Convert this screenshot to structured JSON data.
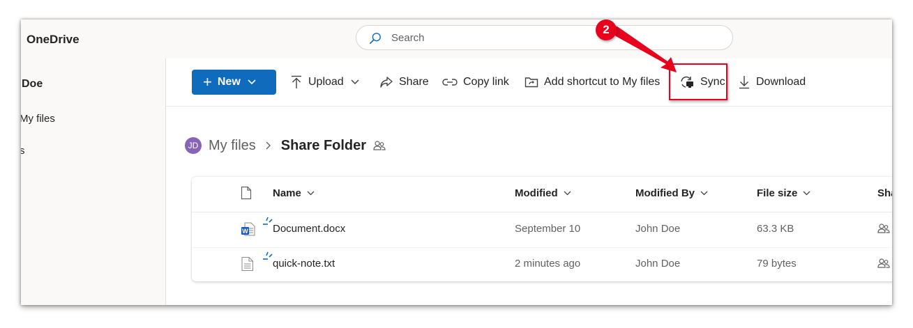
{
  "app": {
    "title": "OneDrive"
  },
  "search": {
    "placeholder": "Search"
  },
  "sidebar": {
    "user": "Doe",
    "items": [
      {
        "label": "My files"
      },
      {
        "label": "s"
      }
    ]
  },
  "toolbar": {
    "new_label": "New",
    "upload_label": "Upload",
    "share_label": "Share",
    "copy_link_label": "Copy link",
    "add_shortcut_label": "Add shortcut to My files",
    "sync_label": "Sync",
    "download_label": "Download"
  },
  "breadcrumb": {
    "avatar_initials": "JD",
    "items": [
      {
        "label": "My files"
      },
      {
        "label": "Share Folder"
      }
    ]
  },
  "table": {
    "columns": [
      {
        "label": "Name"
      },
      {
        "label": "Modified"
      },
      {
        "label": "Modified By"
      },
      {
        "label": "File size"
      },
      {
        "label": "Sha"
      }
    ],
    "rows": [
      {
        "icon": "word-doc-icon",
        "name": "Document.docx",
        "modified": "September 10",
        "modified_by": "John Doe",
        "file_size": "63.3 KB"
      },
      {
        "icon": "text-file-icon",
        "name": "quick-note.txt",
        "modified": "2 minutes ago",
        "modified_by": "John Doe",
        "file_size": "79 bytes"
      }
    ]
  },
  "annotation": {
    "step_number": "2",
    "color": "#e8001c"
  },
  "colors": {
    "accent": "#0f6cbd",
    "avatar": "#8764b8"
  }
}
